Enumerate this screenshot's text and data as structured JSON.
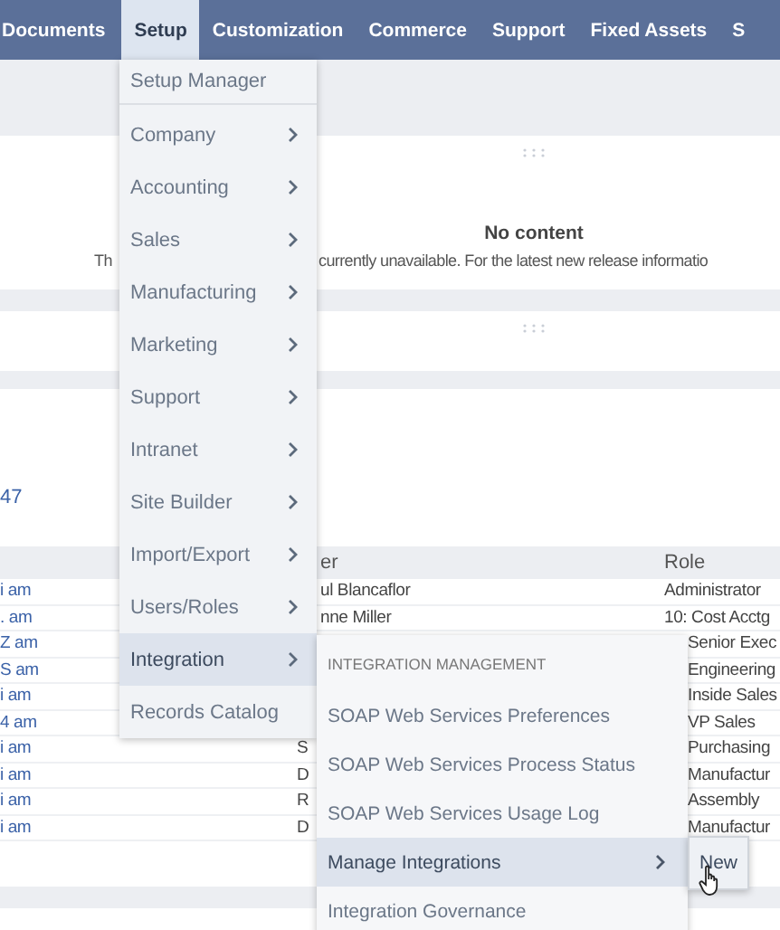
{
  "nav": {
    "items": [
      {
        "label": "Documents",
        "selected": false
      },
      {
        "label": "Setup",
        "selected": true
      },
      {
        "label": "Customization",
        "selected": false
      },
      {
        "label": "Commerce",
        "selected": false
      },
      {
        "label": "Support",
        "selected": false
      },
      {
        "label": "Fixed Assets",
        "selected": false
      },
      {
        "label": "S",
        "selected": false
      }
    ]
  },
  "notice": {
    "title": "No content",
    "text_start": "Th",
    "text_end": "currently unavailable. For the latest new release informatio"
  },
  "link_fragment": "47",
  "table": {
    "columns": {
      "column_2": "er",
      "role": "Role"
    },
    "rows": [
      {
        "column_1": "i am",
        "column_2": "ul Blancaflor",
        "role": "Administrator"
      },
      {
        "column_1": ". am",
        "column_2": "nne Miller",
        "role": "10: Cost Acctg"
      },
      {
        "column_1": "Z am",
        "role": "Senior Exec"
      },
      {
        "column_1": "S am",
        "role": "Engineering"
      },
      {
        "column_1": "i am",
        "role": "Inside Sales"
      },
      {
        "column_1": "4 am",
        "role": "VP Sales"
      },
      {
        "column_1": "i am",
        "column_2": "S",
        "role": "Purchasing"
      },
      {
        "column_1": "i am",
        "column_2": "D",
        "role": "Manufactur"
      },
      {
        "column_1": "i am",
        "column_2": "R",
        "role": "Assembly"
      },
      {
        "column_1": "i am",
        "column_2": "D",
        "role": "Manufactur"
      }
    ]
  },
  "setup_menu": {
    "items": [
      {
        "label": "Setup Manager",
        "has_submenu": false,
        "selected": false
      },
      {
        "label": "Company",
        "has_submenu": true,
        "selected": false
      },
      {
        "label": "Accounting",
        "has_submenu": true,
        "selected": false
      },
      {
        "label": "Sales",
        "has_submenu": true,
        "selected": false
      },
      {
        "label": "Manufacturing",
        "has_submenu": true,
        "selected": false
      },
      {
        "label": "Marketing",
        "has_submenu": true,
        "selected": false
      },
      {
        "label": "Support",
        "has_submenu": true,
        "selected": false
      },
      {
        "label": "Intranet",
        "has_submenu": true,
        "selected": false
      },
      {
        "label": "Site Builder",
        "has_submenu": true,
        "selected": false
      },
      {
        "label": "Import/Export",
        "has_submenu": true,
        "selected": false
      },
      {
        "label": "Users/Roles",
        "has_submenu": true,
        "selected": false
      },
      {
        "label": "Integration",
        "has_submenu": true,
        "selected": true
      },
      {
        "label": "Records Catalog",
        "has_submenu": false,
        "selected": false
      }
    ]
  },
  "integration_submenu": {
    "heading": "INTEGRATION MANAGEMENT",
    "items": [
      {
        "label": "SOAP Web Services Preferences",
        "has_submenu": false,
        "selected": false
      },
      {
        "label": "SOAP Web Services Process Status",
        "has_submenu": false,
        "selected": false
      },
      {
        "label": "SOAP Web Services Usage Log",
        "has_submenu": false,
        "selected": false
      },
      {
        "label": "Manage Integrations",
        "has_submenu": true,
        "selected": true
      },
      {
        "label": "Integration Governance",
        "has_submenu": false,
        "selected": false
      }
    ]
  },
  "manage_submenu": {
    "items": [
      {
        "label": "New"
      }
    ]
  }
}
